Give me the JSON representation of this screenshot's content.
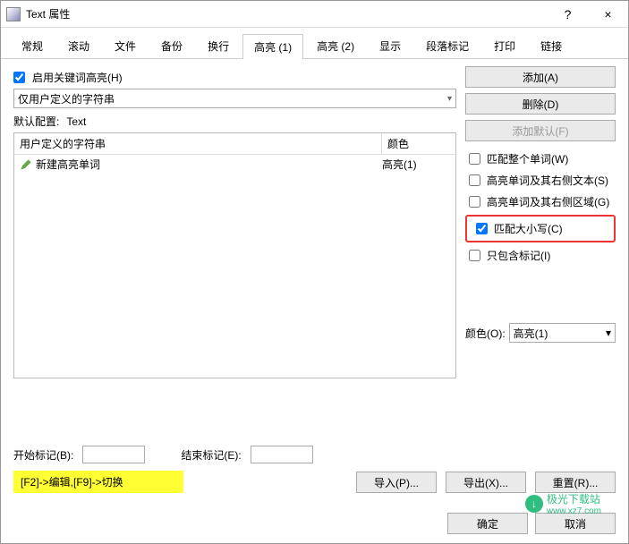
{
  "window": {
    "title": "Text 属性",
    "help": "?",
    "close": "×"
  },
  "tabs": {
    "items": [
      "常规",
      "滚动",
      "文件",
      "备份",
      "换行",
      "高亮 (1)",
      "高亮 (2)",
      "显示",
      "段落标记",
      "打印",
      "链接"
    ],
    "active_index": 5
  },
  "enable_checkbox": {
    "label": "启用关键词高亮(H)",
    "checked": true
  },
  "main_select": {
    "value": "仅用户定义的字符串"
  },
  "default_config": {
    "label": "默认配置:",
    "value": "Text"
  },
  "buttons": {
    "add": "添加(A)",
    "delete": "删除(D)",
    "add_default": "添加默认(F)",
    "import": "导入(P)...",
    "export": "导出(X)...",
    "reset": "重置(R)...",
    "ok": "确定",
    "cancel": "取消"
  },
  "list": {
    "header": {
      "col1": "用户定义的字符串",
      "col2": "颜色"
    },
    "rows": [
      {
        "text": "新建高亮单词",
        "color": "高亮(1)"
      }
    ]
  },
  "options": {
    "whole_word": {
      "label": "匹配整个单词(W)",
      "checked": false
    },
    "right_text": {
      "label": "高亮单词及其右侧文本(S)",
      "checked": false
    },
    "right_region": {
      "label": "高亮单词及其右侧区域(G)",
      "checked": false
    },
    "match_case": {
      "label": "匹配大小写(C)",
      "checked": true
    },
    "tags_only": {
      "label": "只包含标记(I)",
      "checked": false
    }
  },
  "color_select": {
    "label": "颜色(O):",
    "value": "高亮(1)"
  },
  "markers": {
    "start_label": "开始标记(B):",
    "start_value": "",
    "end_label": "结束标记(E):",
    "end_value": ""
  },
  "hint": "[F2]->编辑,[F9]->切换",
  "watermark": {
    "line1": "极光下载站",
    "line2": "www.xz7.com"
  }
}
